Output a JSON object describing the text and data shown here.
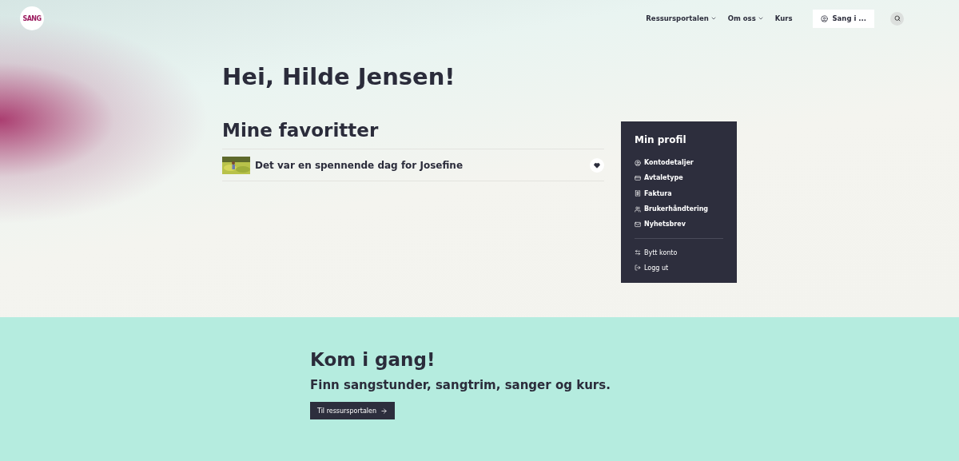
{
  "header": {
    "logo": "SANG",
    "nav": [
      {
        "label": "Ressursportalen",
        "has_menu": true
      },
      {
        "label": "Om oss",
        "has_menu": true
      },
      {
        "label": "Kurs",
        "has_menu": false
      }
    ],
    "account_button": "Sang i ..."
  },
  "greeting": "Hei, Hilde Jensen!",
  "favorites": {
    "title": "Mine favoritter",
    "items": [
      {
        "title": "Det var en spennende dag for Josefine",
        "favorited": true
      }
    ]
  },
  "profile": {
    "title": "Min profil",
    "items": [
      {
        "label": "Kontodetaljer"
      },
      {
        "label": "Avtaletype"
      },
      {
        "label": "Faktura"
      },
      {
        "label": "Brukerhåndtering"
      },
      {
        "label": "Nyhetsbrev"
      }
    ],
    "account_items": [
      {
        "label": "Bytt konto"
      },
      {
        "label": "Logg ut"
      }
    ]
  },
  "cta": {
    "title": "Kom i gang!",
    "subtitle": "Finn sangstunder, sangtrim, sanger og kurs.",
    "button": "Til ressursportalen"
  }
}
